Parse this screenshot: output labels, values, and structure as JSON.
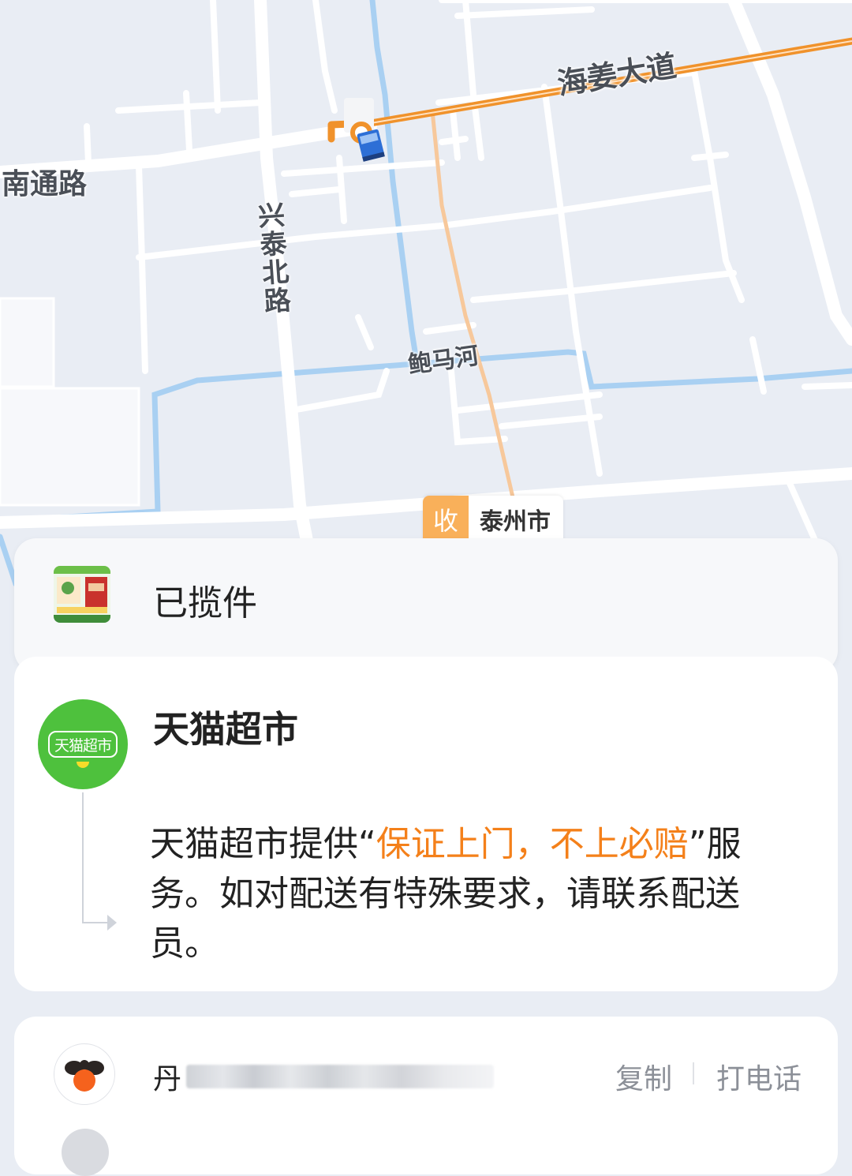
{
  "map": {
    "labels": {
      "road_nantong": "南通路",
      "road_haijiang": "海姜大道",
      "road_xingtai": "兴泰北路",
      "river_baoma": "鲍马河"
    },
    "destination": {
      "badge": "收",
      "city": "泰州市"
    },
    "colors": {
      "route": "#f0922b",
      "water": "#a9d0f2",
      "road": "#ffffff",
      "land": "#e9edf4"
    }
  },
  "status_card": {
    "status": "已揽件",
    "product_thumb_icon": "product-package-thumbnail"
  },
  "info_card": {
    "shop_name": "天猫超市",
    "logo_text": "天猫超市",
    "notice_prefix": "天猫超市提供“",
    "notice_highlight": "保证上门，不上必赔",
    "notice_suffix": "”服务。如对配送有特殊要求，请联系配送员。",
    "highlight_color": "#f4801a"
  },
  "courier_card": {
    "name_prefix": "丹",
    "copy_label": "复制",
    "call_label": "打电话",
    "avatar_icon": "courier-bee-icon"
  }
}
